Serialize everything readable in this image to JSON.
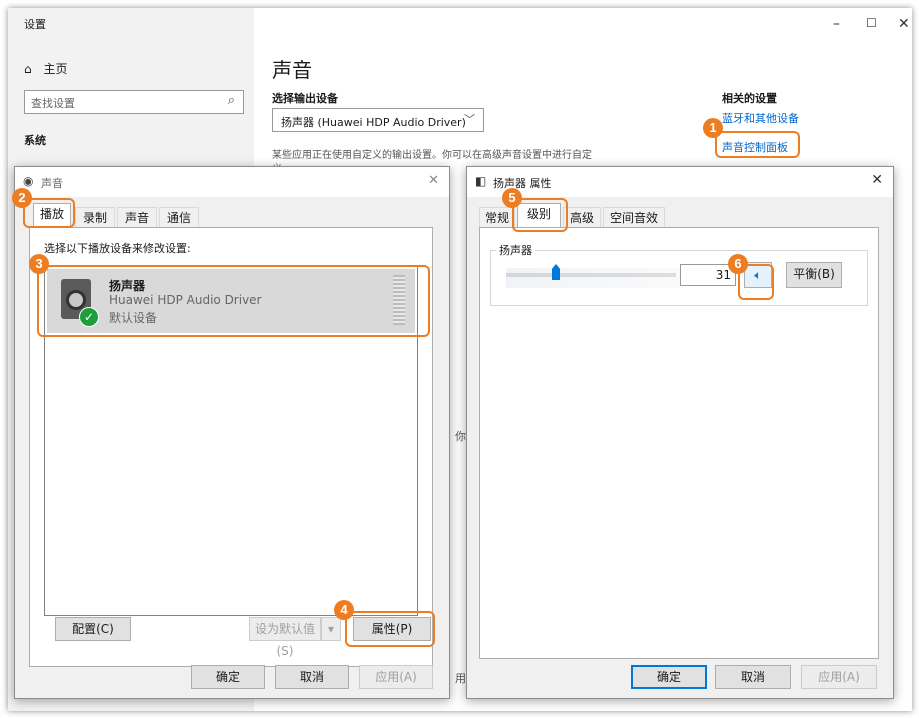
{
  "settings": {
    "window_title": "设置",
    "home_label": "主页",
    "search_placeholder": "查找设置",
    "section_system": "系统",
    "page_title": "声音",
    "output_label": "选择输出设备",
    "output_device": "扬声器 (Huawei HDP Audio Driver)",
    "note_text": "某些应用正在使用自定义的输出设置。你可以在高级声音设置中进行自定",
    "note_text_cont": "义",
    "related_title": "相关的设置",
    "related_bluetooth": "蓝牙和其他设备",
    "related_sound_panel": "声音控制面板",
    "bg_fragment_1": "你",
    "bg_fragment_2": "用"
  },
  "sound_dialog": {
    "title": "声音",
    "tabs": [
      "播放",
      "录制",
      "声音",
      "通信"
    ],
    "instruction": "选择以下播放设备来修改设置:",
    "device_name": "扬声器",
    "device_driver": "Huawei HDP Audio Driver",
    "device_status": "默认设备",
    "configure_btn": "配置(C)",
    "set_default_btn": "设为默认值(S)",
    "properties_btn": "属性(P)",
    "ok_btn": "确定",
    "cancel_btn": "取消",
    "apply_btn": "应用(A)"
  },
  "speaker_dialog": {
    "title": "扬声器 属性",
    "tabs": [
      "常规",
      "级别",
      "高级",
      "空间音效"
    ],
    "group_label": "扬声器",
    "level_value": "31",
    "balance_btn": "平衡(B)",
    "ok_btn": "确定",
    "cancel_btn": "取消",
    "apply_btn": "应用(A)"
  },
  "callouts": [
    "1",
    "2",
    "3",
    "4",
    "5",
    "6"
  ],
  "icons": {
    "home": "home-icon",
    "search": "search-icon",
    "chevron": "chevron-down-icon",
    "speaker": "speaker-icon",
    "check": "check-icon",
    "mute_toggle": "volume-icon"
  },
  "colors": {
    "callout": "#ed7d22",
    "link": "#0066cc",
    "accent": "#0078d7",
    "check_green": "#1e9e3a"
  }
}
